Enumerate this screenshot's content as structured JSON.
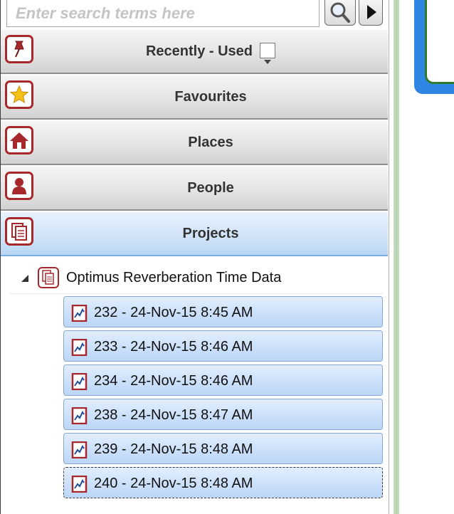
{
  "search": {
    "placeholder": "Enter search terms here"
  },
  "categories": [
    {
      "label": "Recently - Used",
      "icon": "pushpin-icon"
    },
    {
      "label": "Favourites",
      "icon": "star-icon"
    },
    {
      "label": "Places",
      "icon": "house-icon"
    },
    {
      "label": "People",
      "icon": "person-icon"
    },
    {
      "label": "Projects",
      "icon": "document-icon"
    }
  ],
  "tree": {
    "root": {
      "label": "Optimus Reverberation Time Data",
      "expanded": true
    },
    "items": [
      {
        "label": "232 - 24-Nov-15 8:45 AM"
      },
      {
        "label": "233 - 24-Nov-15 8:46 AM"
      },
      {
        "label": "234 - 24-Nov-15 8:46 AM"
      },
      {
        "label": "238 - 24-Nov-15 8:47 AM"
      },
      {
        "label": "239 - 24-Nov-15 8:48 AM"
      },
      {
        "label": "240 - 24-Nov-15 8:48 AM"
      }
    ]
  },
  "colors": {
    "accent_red": "#a7282b",
    "selection_blue": "#cadffa",
    "card_blue": "#2f86e3",
    "card_green": "#2f7a2f"
  }
}
